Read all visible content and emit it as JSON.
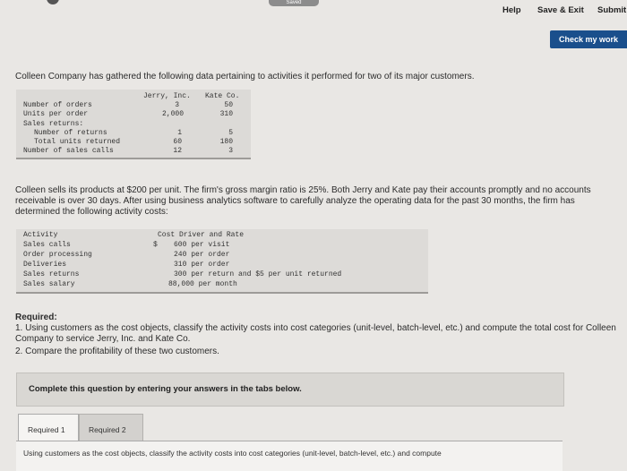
{
  "topbar": {
    "saved": "Saved",
    "help": "Help",
    "save_exit": "Save & Exit",
    "submit": "Submit"
  },
  "check_button": "Check my work",
  "intro": "Colleen Company has gathered the following data pertaining to activities it performed for two of its major customers.",
  "table1": {
    "headers": [
      "Jerry, Inc.",
      "Kate Co."
    ],
    "rows": [
      {
        "label": "Number of orders",
        "jerry": "3",
        "kate": "50"
      },
      {
        "label": "Units per order",
        "jerry": "2,000",
        "kate": "310"
      },
      {
        "label": "Sales returns:",
        "jerry": "",
        "kate": ""
      },
      {
        "label": "Number of returns",
        "jerry": "1",
        "kate": "5"
      },
      {
        "label": "Total units returned",
        "jerry": "60",
        "kate": "180"
      },
      {
        "label": "Number of sales calls",
        "jerry": "12",
        "kate": "3"
      }
    ]
  },
  "para2": "Colleen sells its products at $200 per unit. The firm's gross margin ratio is 25%. Both Jerry and Kate pay their accounts promptly and no accounts receivable is over 30 days. After using business analytics software to carefully analyze the operating data for the past 30 months, the firm has determined the following activity costs:",
  "table2": {
    "header_activity": "Activity",
    "header_driver": "Cost Driver and Rate",
    "dollar": "$",
    "rows": [
      {
        "activity": "Sales calls",
        "rate": "600 per visit"
      },
      {
        "activity": "Order processing",
        "rate": "240 per order"
      },
      {
        "activity": "Deliveries",
        "rate": "310 per order"
      },
      {
        "activity": "Sales returns",
        "rate": "300 per return and $5 per unit returned"
      },
      {
        "activity": "Sales salary",
        "rate": "88,000 per month"
      }
    ]
  },
  "required": {
    "title": "Required:",
    "item1": "1. Using customers as the cost objects, classify the activity costs into cost categories (unit-level, batch-level, etc.) and compute the total cost for Colleen Company to service Jerry, Inc. and Kate Co.",
    "item2": "2. Compare the profitability of these two customers."
  },
  "complete_text": "Complete this question by entering your answers in the tabs below.",
  "tabs": [
    "Required 1",
    "Required 2"
  ],
  "tab_content": "Using customers as the cost objects, classify the activity costs into cost categories (unit-level, batch-level, etc.) and compute"
}
